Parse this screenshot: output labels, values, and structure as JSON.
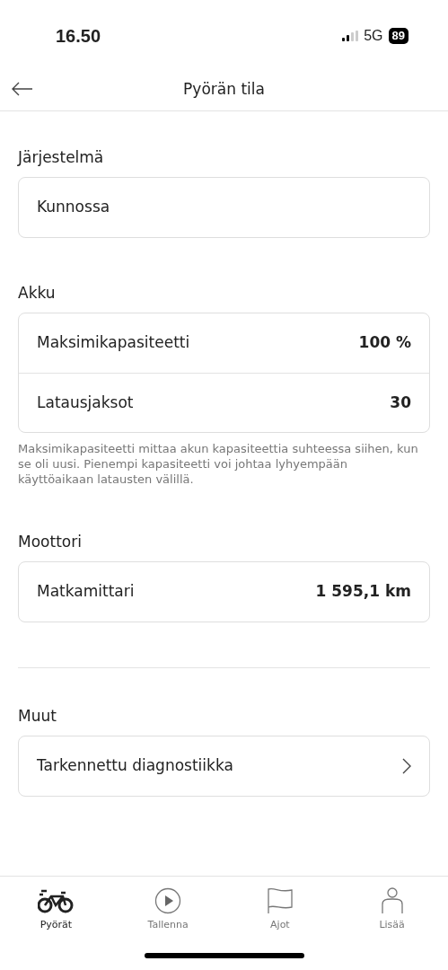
{
  "status_bar": {
    "time": "16.50",
    "network": "5G",
    "battery": "89"
  },
  "header": {
    "title": "Pyörän tila"
  },
  "sections": [
    {
      "title": "Järjestelmä",
      "divider_before": false,
      "rows": [
        {
          "kind": "text",
          "label": "Kunnossa"
        }
      ]
    },
    {
      "title": "Akku",
      "divider_before": false,
      "rows": [
        {
          "kind": "value",
          "label": "Maksimikapasiteetti",
          "value": "100 %"
        },
        {
          "kind": "value",
          "label": "Latausjaksot",
          "value": "30"
        }
      ],
      "note": "Maksimikapasiteetti mittaa akun kapasiteettia suhteessa siihen, kun se oli uusi. Pienempi kapasiteetti voi johtaa lyhyempään käyttöaikaan latausten välillä."
    },
    {
      "title": "Moottori",
      "divider_before": false,
      "rows": [
        {
          "kind": "value",
          "label": "Matkamittari",
          "value": "1 595,1 km"
        }
      ]
    },
    {
      "title": "Muut",
      "divider_before": true,
      "rows": [
        {
          "kind": "link",
          "label": "Tarkennettu diagnostiikka"
        }
      ]
    }
  ],
  "tabs": [
    {
      "label": "Pyörät",
      "selected": true
    },
    {
      "label": "Tallenna",
      "selected": false
    },
    {
      "label": "Ajot",
      "selected": false
    },
    {
      "label": "Lisää",
      "selected": false
    }
  ]
}
